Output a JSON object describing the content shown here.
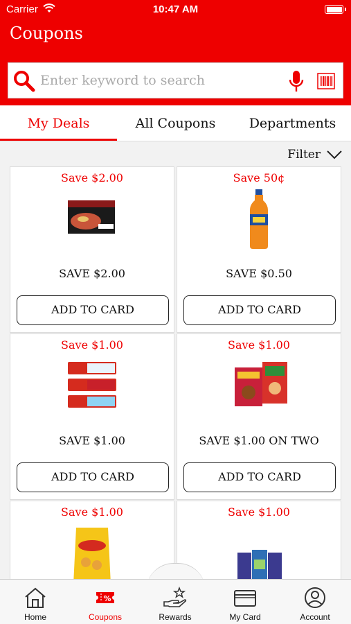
{
  "status": {
    "carrier": "Carrier",
    "time": "10:47 AM"
  },
  "header": {
    "title": "Coupons"
  },
  "search": {
    "placeholder": "Enter keyword to search"
  },
  "tabs": [
    {
      "label": "My Deals",
      "active": true
    },
    {
      "label": "All Coupons",
      "active": false
    },
    {
      "label": "Departments",
      "active": false
    }
  ],
  "filter": {
    "label": "Filter"
  },
  "coupons": [
    {
      "save": "Save $2.00",
      "desc": "SAVE $2.00",
      "button": "ADD TO CARD",
      "image": "frozen-pizza-box"
    },
    {
      "save": "Save 50¢",
      "desc": "SAVE $0.50",
      "button": "ADD TO CARD",
      "image": "orange-soda-bottle"
    },
    {
      "save": "Save $1.00",
      "desc": "SAVE $1.00",
      "button": "ADD TO CARD",
      "image": "toothpaste-tubes"
    },
    {
      "save": "Save $1.00",
      "desc": "SAVE $1.00 ON TWO",
      "button": "ADD TO CARD",
      "image": "cereal-boxes"
    },
    {
      "save": "Save $1.00",
      "image": "snack-bag"
    },
    {
      "save": "Save $1.00",
      "image": "paper-towel-pack"
    }
  ],
  "tabbar": [
    {
      "label": "Home",
      "icon": "home-icon",
      "active": false
    },
    {
      "label": "Coupons",
      "icon": "coupon-icon",
      "active": true
    },
    {
      "label": "Rewards",
      "icon": "rewards-icon",
      "active": false
    },
    {
      "label": "My Card",
      "icon": "card-icon",
      "active": false
    },
    {
      "label": "Account",
      "icon": "account-icon",
      "active": false
    }
  ],
  "colors": {
    "brand": "#ee0000",
    "background": "#f2f2f2"
  }
}
